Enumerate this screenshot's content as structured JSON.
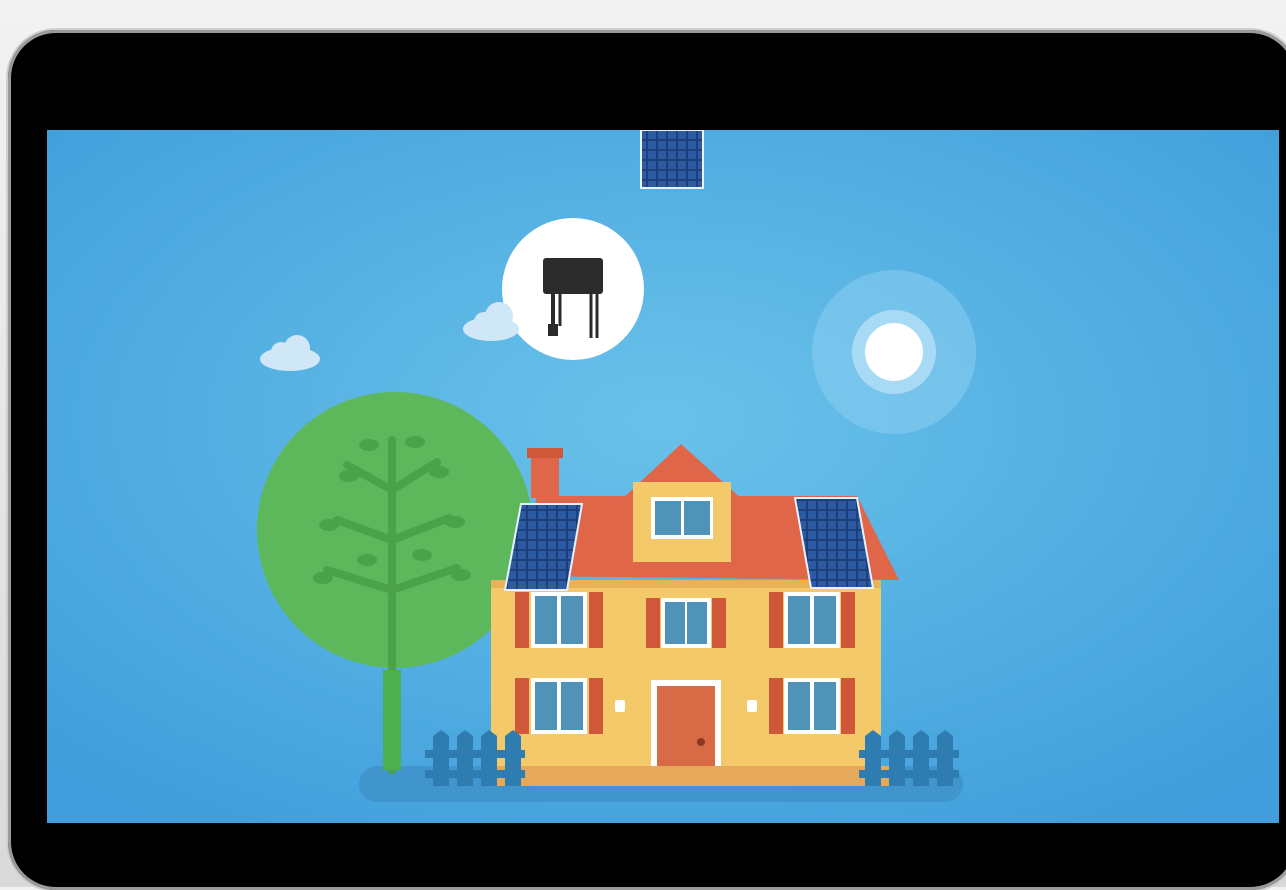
{
  "scene": {
    "description_colors": {
      "sky": "#4aa8e0",
      "sky_center": "#6cc3ea",
      "tree": "#5cb85c",
      "trunk": "#4caf50",
      "wall": "#f4c96a",
      "roof": "#e0664a",
      "shutter": "#d0583a",
      "window_glass": "#4f94b8",
      "door": "#d86a45",
      "fence": "#2f7db0",
      "solar_panel": "#1d3f7a",
      "sun": "#ffffff"
    },
    "icons": [
      "solar-panel-icon",
      "microinverter-icon",
      "cloud-icon",
      "sun-icon",
      "tree-icon",
      "house-icon",
      "fence-icon"
    ]
  }
}
